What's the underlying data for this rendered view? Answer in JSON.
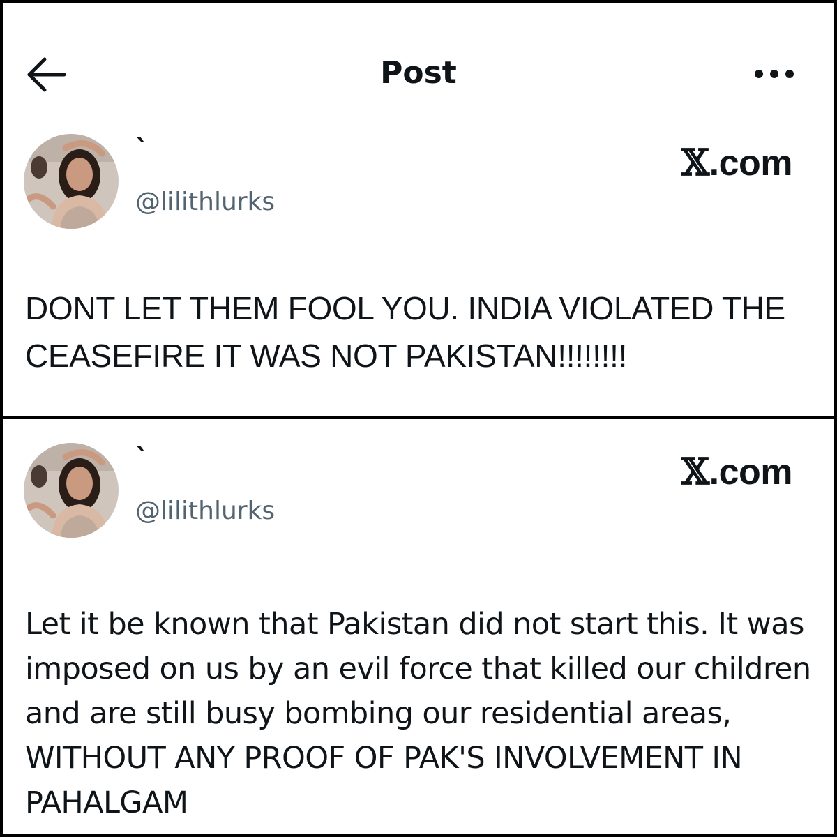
{
  "header": {
    "title": "Post",
    "back_icon": "arrow-left-icon",
    "more_icon": "more-horizontal-icon"
  },
  "posts": [
    {
      "author": {
        "display_name": "`",
        "handle": "@lilithlurks"
      },
      "watermark": {
        "logo": "𝕏",
        "suffix": ".com"
      },
      "text": "DONT LET THEM FOOL YOU. INDIA VIOLATED THE CEASEFIRE IT WAS NOT PAKISTAN!!!!!!!!"
    },
    {
      "author": {
        "display_name": "`",
        "handle": "@lilithlurks"
      },
      "watermark": {
        "logo": "𝕏",
        "suffix": ".com"
      },
      "text": "Let it be known that Pakistan did not start this. It was imposed on us by an evil force that killed our children and are still busy bombing our residential areas, WITHOUT ANY PROOF OF PAK'S INVOLVEMENT IN PAHALGAM"
    }
  ],
  "colors": {
    "text_primary": "#0f1419",
    "text_secondary": "#536471",
    "border": "#000000",
    "background": "#ffffff"
  }
}
